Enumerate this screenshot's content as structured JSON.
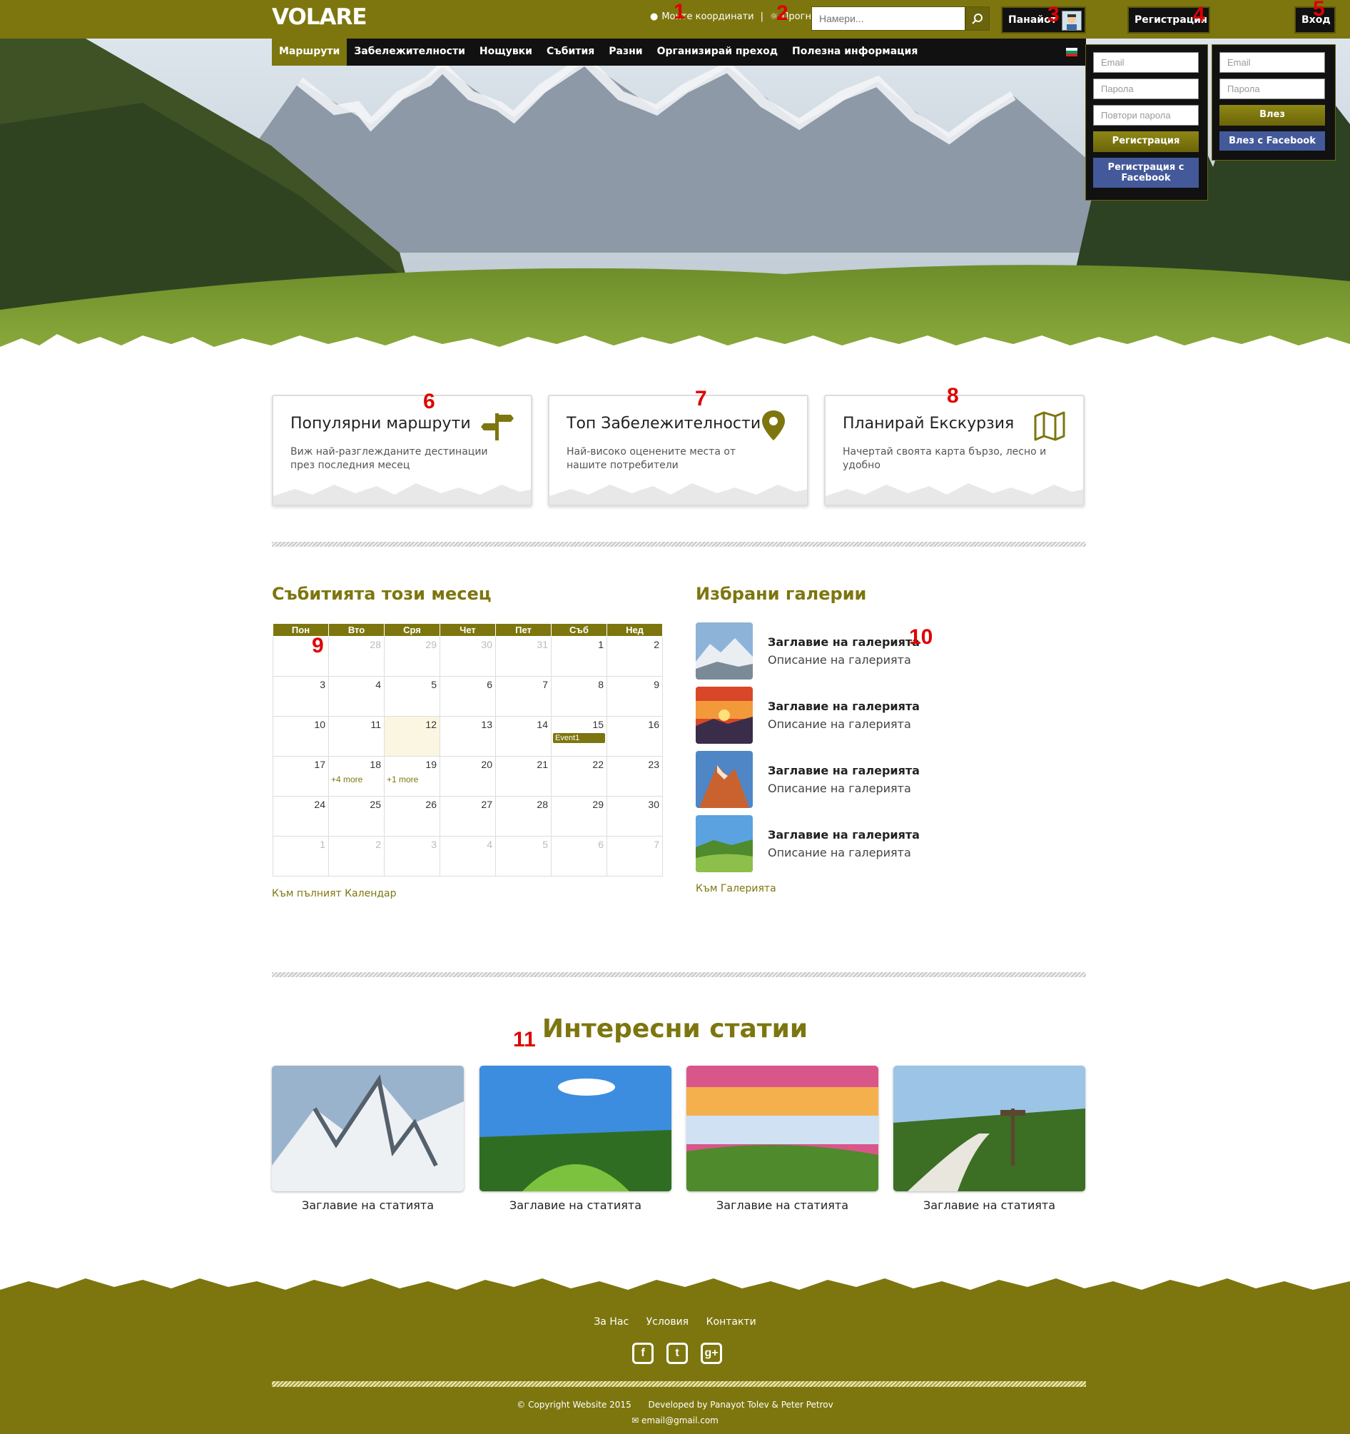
{
  "brand": {
    "logo": "VOLARE",
    "accent": "#7d760f",
    "dark": "#111111",
    "facebook": "#44599a"
  },
  "header": {
    "coords_link": "Моите координати",
    "forecast_link": "Прогноза",
    "search": {
      "placeholder": "Намери..."
    },
    "user_name": "Панайот",
    "register_label": "Регистрация",
    "login_label": "Вход"
  },
  "annotations": [
    "1",
    "2",
    "3",
    "4",
    "5",
    "6",
    "7",
    "8",
    "9",
    "10",
    "11"
  ],
  "nav": {
    "items": [
      {
        "label": "Маршрути",
        "active": true
      },
      {
        "label": "Забележителности",
        "active": false
      },
      {
        "label": "Нощувки",
        "active": false
      },
      {
        "label": "Събития",
        "active": false
      },
      {
        "label": "Разни",
        "active": false
      },
      {
        "label": "Организирай преход",
        "active": false
      },
      {
        "label": "Полезна информация",
        "active": false
      }
    ],
    "language_flag": "bulgarian-flag-icon"
  },
  "register_dropdown": {
    "email": "Email",
    "password": "Парола",
    "repeat_password": "Повтори парола",
    "submit": "Регистрация",
    "facebook": "Регистрация с Facebook"
  },
  "login_dropdown": {
    "email": "Email",
    "password": "Парола",
    "submit": "Влез",
    "facebook": "Влез с Facebook"
  },
  "features": [
    {
      "title": "Популярни маршрути",
      "desc": "Виж най-разглежданите дестинации през последния месец",
      "icon": "signpost-icon"
    },
    {
      "title": "Топ Забележителности",
      "desc": "Най-високо оценените места от нашите потребители",
      "icon": "map-pin-icon"
    },
    {
      "title": "Планирай Екскурзия",
      "desc": "Начертай своята карта бързо, лесно и удобно",
      "icon": "folded-map-icon"
    }
  ],
  "events": {
    "title": "Събитията този месец",
    "weekdays": [
      "Пон",
      "Вто",
      "Сря",
      "Чет",
      "Пет",
      "Съб",
      "Нед"
    ],
    "weeks": [
      [
        {
          "d": "",
          "dim": false
        },
        {
          "d": "28",
          "dim": true
        },
        {
          "d": "29",
          "dim": true
        },
        {
          "d": "30",
          "dim": true
        },
        {
          "d": "31",
          "dim": true
        },
        {
          "d": "1",
          "dim": false
        },
        {
          "d": "2",
          "dim": false
        }
      ],
      [
        {
          "d": "3"
        },
        {
          "d": "4"
        },
        {
          "d": "5"
        },
        {
          "d": "6"
        },
        {
          "d": "7"
        },
        {
          "d": "8"
        },
        {
          "d": "9"
        }
      ],
      [
        {
          "d": "10"
        },
        {
          "d": "11"
        },
        {
          "d": "12",
          "today": true
        },
        {
          "d": "13"
        },
        {
          "d": "14"
        },
        {
          "d": "15",
          "event": "Event1"
        },
        {
          "d": "16"
        }
      ],
      [
        {
          "d": "17"
        },
        {
          "d": "18",
          "more": "+4 more"
        },
        {
          "d": "19",
          "more": "+1 more"
        },
        {
          "d": "20"
        },
        {
          "d": "21"
        },
        {
          "d": "22"
        },
        {
          "d": "23"
        }
      ],
      [
        {
          "d": "24"
        },
        {
          "d": "25"
        },
        {
          "d": "26"
        },
        {
          "d": "27"
        },
        {
          "d": "28"
        },
        {
          "d": "29"
        },
        {
          "d": "30"
        }
      ],
      [
        {
          "d": "1",
          "dim": true
        },
        {
          "d": "2",
          "dim": true
        },
        {
          "d": "3",
          "dim": true
        },
        {
          "d": "4",
          "dim": true
        },
        {
          "d": "5",
          "dim": true
        },
        {
          "d": "6",
          "dim": true
        },
        {
          "d": "7",
          "dim": true
        }
      ]
    ],
    "full_calendar_link": "Към пълният Календар"
  },
  "galleries": {
    "title": "Избрани галерии",
    "items": [
      {
        "title": "Заглавие на галерията",
        "desc": "Описание на галерията"
      },
      {
        "title": "Заглавие на галерията",
        "desc": "Описание на галерията"
      },
      {
        "title": "Заглавие на галерията",
        "desc": "Описание на галерията"
      },
      {
        "title": "Заглавие на галерията",
        "desc": "Описание на галерията"
      }
    ],
    "all_link": "Към Галерията"
  },
  "articles": {
    "title": "Интересни статии",
    "items": [
      {
        "title": "Заглавие на статията"
      },
      {
        "title": "Заглавие на статията"
      },
      {
        "title": "Заглавие на статията"
      },
      {
        "title": "Заглавие на статията"
      }
    ]
  },
  "footer": {
    "links": [
      "За Нас",
      "Условия",
      "Контакти"
    ],
    "social": [
      {
        "icon": "facebook-icon",
        "glyph": "f"
      },
      {
        "icon": "twitter-icon",
        "glyph": "t"
      },
      {
        "icon": "google-plus-icon",
        "glyph": "g+"
      }
    ],
    "copyright": "© Copyright Website 2015",
    "developed": "Developed by Panayot Tolev & Peter Petrov",
    "email": "email@gmail.com"
  }
}
